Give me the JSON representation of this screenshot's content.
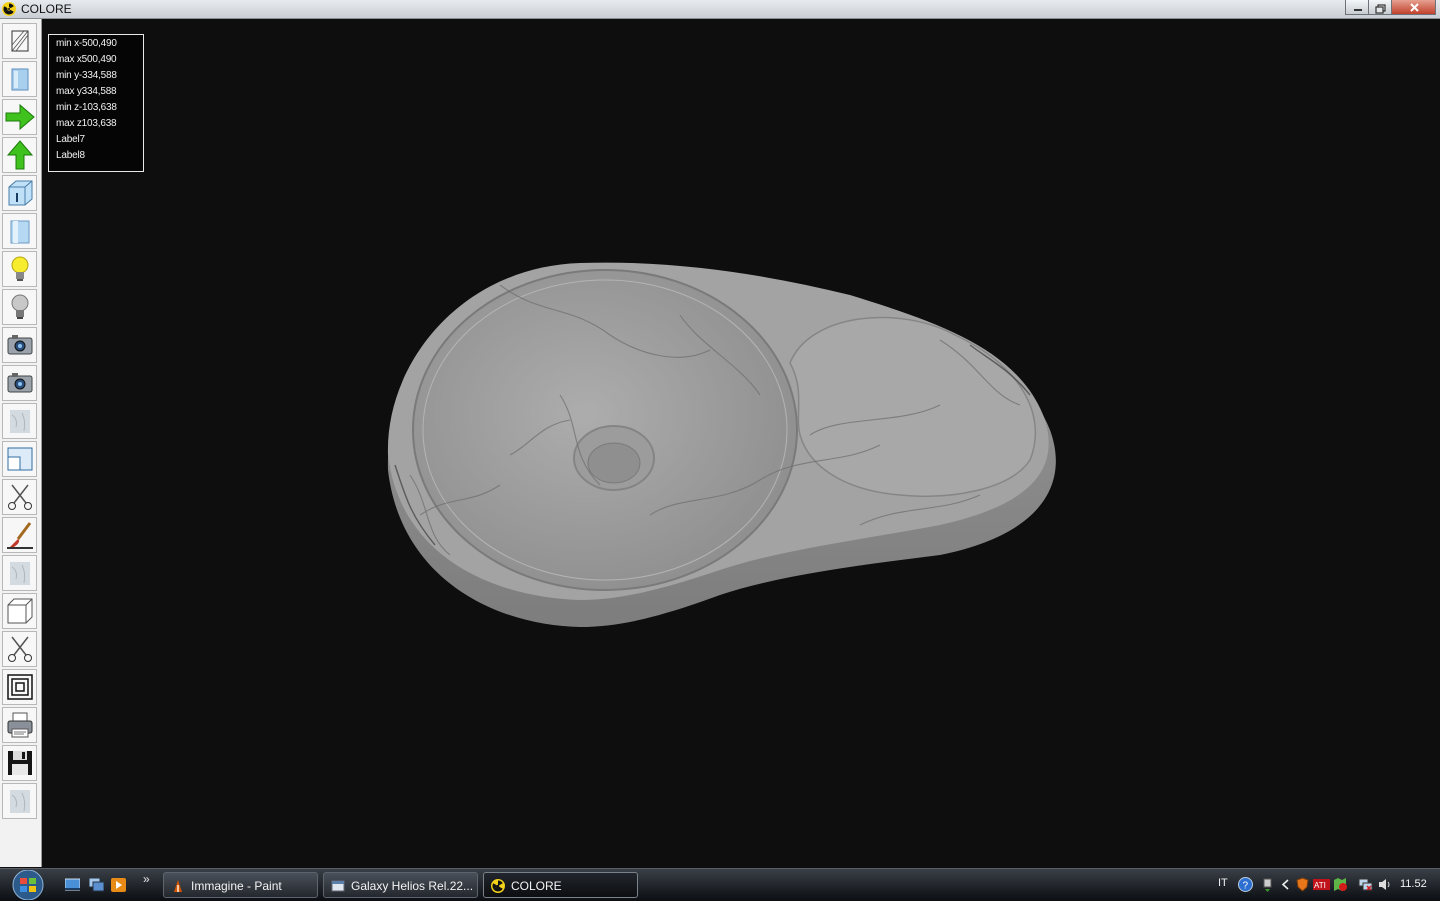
{
  "window": {
    "title": "COLORE",
    "icon": "radiation-icon",
    "controls": [
      "minimize-icon",
      "restore-icon",
      "close-icon"
    ]
  },
  "toolbar": {
    "buttons": [
      {
        "name": "wireframe-view-button",
        "icon": "wireframe-box-icon"
      },
      {
        "name": "solid-panel-button",
        "icon": "blue-panel-icon"
      },
      {
        "name": "rotate-right-button",
        "icon": "green-arrow-right-icon"
      },
      {
        "name": "rotate-up-button",
        "icon": "green-arrow-up-icon"
      },
      {
        "name": "box-info-button",
        "icon": "box-info-icon"
      },
      {
        "name": "cylinder-button",
        "icon": "blue-cylinder-icon"
      },
      {
        "name": "light-on-button",
        "icon": "lightbulb-on-icon"
      },
      {
        "name": "light-off-button",
        "icon": "lightbulb-off-icon"
      },
      {
        "name": "camera-button",
        "icon": "camera-icon"
      },
      {
        "name": "camera-2-button",
        "icon": "camera-icon"
      },
      {
        "name": "texture-button",
        "icon": "marble-texture-icon"
      },
      {
        "name": "window-layout-button",
        "icon": "window-layout-icon"
      },
      {
        "name": "cut-button",
        "icon": "scissors-icon"
      },
      {
        "name": "paint-brush-button",
        "icon": "paintbrush-icon"
      },
      {
        "name": "texture-2-button",
        "icon": "marble-texture-icon"
      },
      {
        "name": "box-view-button",
        "icon": "box-icon"
      },
      {
        "name": "cut-2-button",
        "icon": "scissors-icon"
      },
      {
        "name": "offset-contour-button",
        "icon": "concentric-squares-icon"
      },
      {
        "name": "print-button",
        "icon": "printer-icon"
      },
      {
        "name": "save-button",
        "icon": "floppy-disk-icon"
      },
      {
        "name": "texture-3-button",
        "icon": "marble-texture-icon"
      }
    ]
  },
  "info": {
    "min_x": "min x-500,490",
    "max_x": "max x500,490",
    "min_y": "min y-334,588",
    "max_y": "max y334,588",
    "min_z": "min z-103,638",
    "max_z": "max z103,638",
    "label7": "Label7",
    "label8": "Label8"
  },
  "viewport": {
    "background": "#0e0e0e",
    "model": "marble washbasin 3D render",
    "model_color": "#a6a6a6"
  },
  "taskbar": {
    "start_icon": "windows-start-orb-icon",
    "quick_launch": [
      "show-desktop-icon",
      "switch-windows-icon",
      "media-player-icon"
    ],
    "overflow": "»",
    "tasks": [
      {
        "label": "Immagine - Paint",
        "icon": "paint-icon",
        "active": false
      },
      {
        "label": "Galaxy Helios  Rel.22...",
        "icon": "app-window-icon",
        "active": false
      },
      {
        "label": "COLORE",
        "icon": "radiation-icon",
        "active": true
      }
    ],
    "language": "IT",
    "tray_icons": [
      "help-icon",
      "safely-remove-icon",
      "chevron-left-icon",
      "shield-icon",
      "ati-icon",
      "security-center-icon",
      "network-icon",
      "volume-icon"
    ],
    "clock": "11.52"
  }
}
